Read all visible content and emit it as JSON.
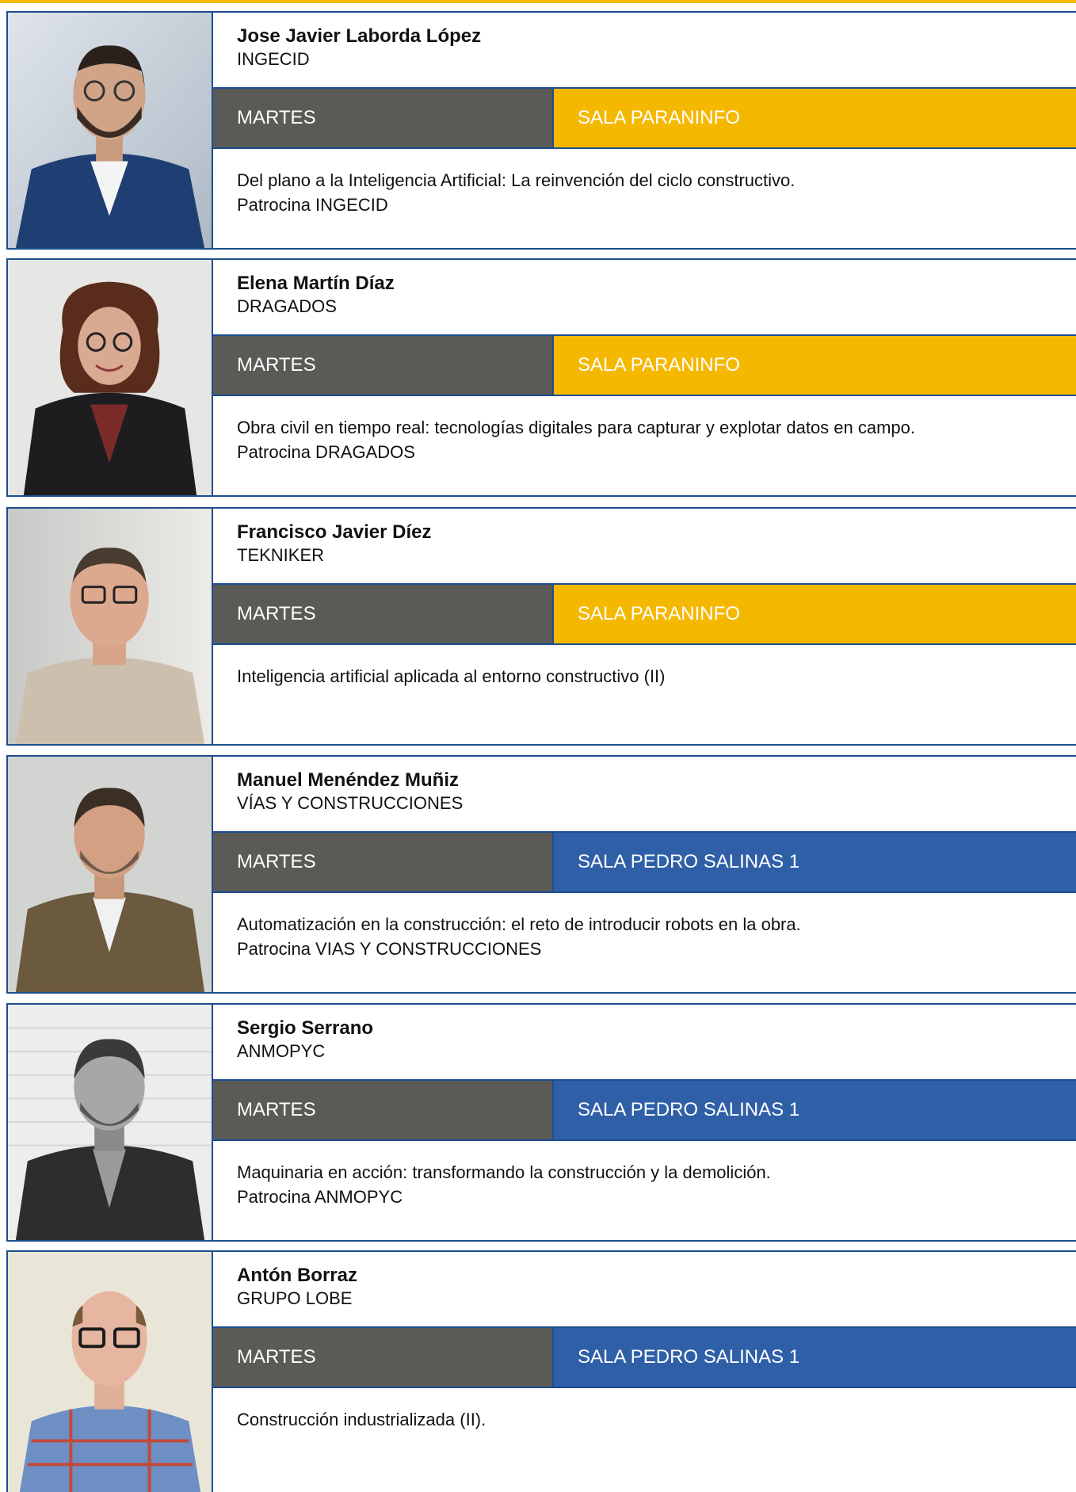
{
  "colors": {
    "accent_yellow": "#f5b800",
    "accent_blue": "#2f5fa7",
    "day_grey": "#5a5a57",
    "rule_blue": "#1d4e8f"
  },
  "speakers": [
    {
      "name": "Jose Javier Laborda López",
      "org": "INGECID",
      "day": "MARTES",
      "room": "SALA PARANINFO",
      "room_color": "#f5b800",
      "talk": "Del plano a la Inteligencia Artificial: La reinvención del ciclo constructivo.",
      "sponsor": "Patrocina INGECID"
    },
    {
      "name": "Elena Martín Díaz",
      "org": "DRAGADOS",
      "day": "MARTES",
      "room": "SALA PARANINFO",
      "room_color": "#f5b800",
      "talk": "Obra civil en tiempo real: tecnologías digitales para capturar y explotar datos en campo.",
      "sponsor": "Patrocina DRAGADOS"
    },
    {
      "name": "Francisco Javier Díez",
      "org": "TEKNIKER",
      "day": "MARTES",
      "room": "SALA PARANINFO",
      "room_color": "#f5b800",
      "talk": "Inteligencia artificial aplicada al entorno constructivo (II)",
      "sponsor": ""
    },
    {
      "name": "Manuel Menéndez Muñiz",
      "org": "VÍAS Y CONSTRUCCIONES",
      "day": "MARTES",
      "room": "SALA PEDRO SALINAS 1",
      "room_color": "#2f5fa7",
      "talk": "Automatización en la construcción: el reto de introducir robots en la obra.",
      "sponsor": "Patrocina VIAS Y CONSTRUCCIONES"
    },
    {
      "name": "Sergio Serrano",
      "org": "ANMOPYC",
      "day": "MARTES",
      "room": "SALA PEDRO SALINAS 1",
      "room_color": "#2f5fa7",
      "talk": "Maquinaria en acción: transformando la construcción y la demolición.",
      "sponsor": "Patrocina ANMOPYC"
    },
    {
      "name": "Antón Borraz",
      "org": "GRUPO LOBE",
      "day": "MARTES",
      "room": "SALA PEDRO SALINAS 1",
      "room_color": "#2f5fa7",
      "talk": "Construcción industrializada (II).",
      "sponsor": ""
    }
  ]
}
